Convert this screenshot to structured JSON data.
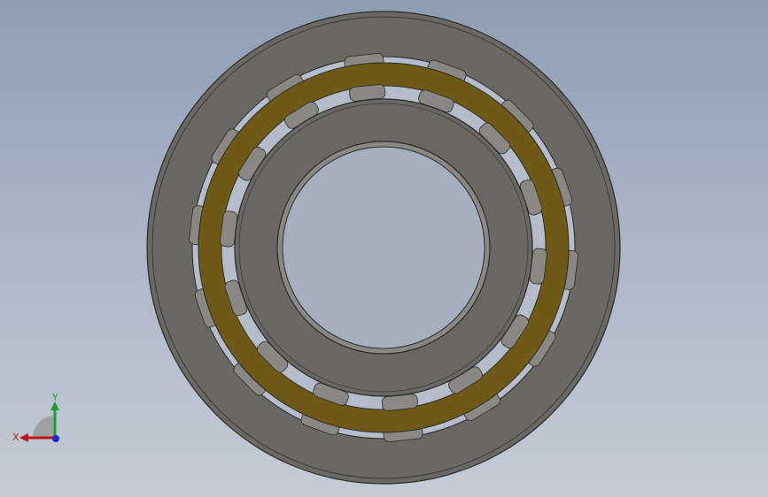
{
  "viewport": {
    "background_top": "#8f9db2",
    "background_bottom": "#c4cbd6"
  },
  "model": {
    "outer_ring_color": "#6a6864",
    "inner_ring_color": "#6a6864",
    "cage_color": "#6e5a16",
    "roller_color": "#8a8884",
    "edge_color": "#2a2a2a"
  },
  "triad": {
    "x_label": "X",
    "y_label": "Y",
    "x_color": "#c0141a",
    "y_color": "#1f9e2e",
    "z_color": "#1a2ad0"
  }
}
